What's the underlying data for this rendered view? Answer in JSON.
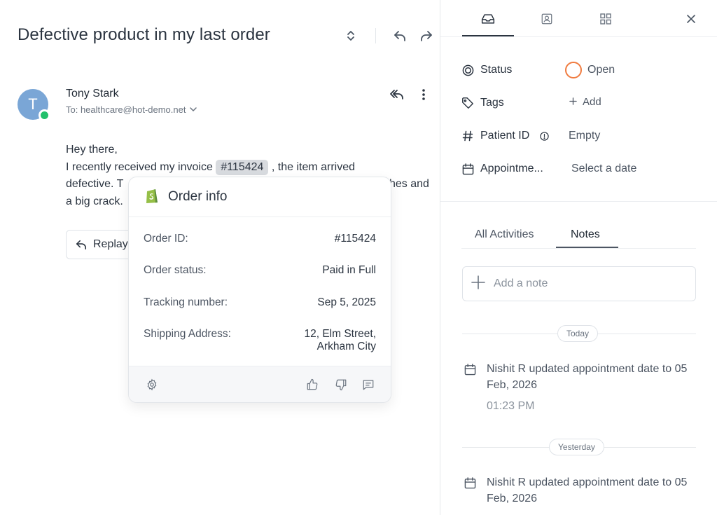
{
  "conversation": {
    "title": "Defective product in my last order",
    "sender_name": "Tony Stark",
    "avatar_initial": "T",
    "to_line": "To: healthcare@hot-demo.net",
    "greeting": "Hey there,",
    "body_part1": "I recently received my invoice",
    "invoice_chip": "#115424",
    "body_part2": ", the item arrived",
    "body_line2_start": "defective. T",
    "body_line2_end": "hes and",
    "body_line3": "a big crack.",
    "replay_label": "Replay"
  },
  "order_popover": {
    "title": "Order info",
    "rows": [
      {
        "label": "Order ID:",
        "value": "#115424"
      },
      {
        "label": "Order status:",
        "value": "Paid in Full"
      },
      {
        "label": "Tracking number:",
        "value": "Sep 5, 2025"
      },
      {
        "label": "Shipping Address:",
        "value_line1": "12, Elm Street,",
        "value_line2": "Arkham City"
      }
    ]
  },
  "sidebar": {
    "properties": {
      "status_label": "Status",
      "status_value": "Open",
      "tags_label": "Tags",
      "tags_add": "Add",
      "patient_id_label": "Patient ID",
      "patient_id_value": "Empty",
      "appointment_label": "Appointme...",
      "appointment_value": "Select a date"
    },
    "activity_tabs": [
      "All Activities",
      "Notes"
    ],
    "active_tab": "Notes",
    "note_placeholder": "Add a note",
    "groups": [
      {
        "day": "Today",
        "text": "Nishit R updated appointment date to 05 Feb, 2026",
        "time": "01:23 PM"
      },
      {
        "day": "Yesterday",
        "text": "Nishit R updated appointment date to 05 Feb, 2026"
      }
    ]
  },
  "colors": {
    "status_open": "#f07b3f",
    "presence": "#22c06b",
    "avatar": "#7aa6d6",
    "shopify": "#95bf47"
  },
  "icons": [
    "sort-toggle-icon",
    "reply-icon",
    "forward-icon",
    "reply-all-icon",
    "more-vertical-icon",
    "inbox-icon",
    "contact-icon",
    "apps-grid-icon",
    "close-icon",
    "status-icon",
    "tag-icon",
    "hash-icon",
    "info-icon",
    "calendar-icon",
    "settings-icon",
    "thumbs-up-icon",
    "thumbs-down-icon",
    "comment-icon",
    "shopify-icon",
    "plus-icon"
  ]
}
